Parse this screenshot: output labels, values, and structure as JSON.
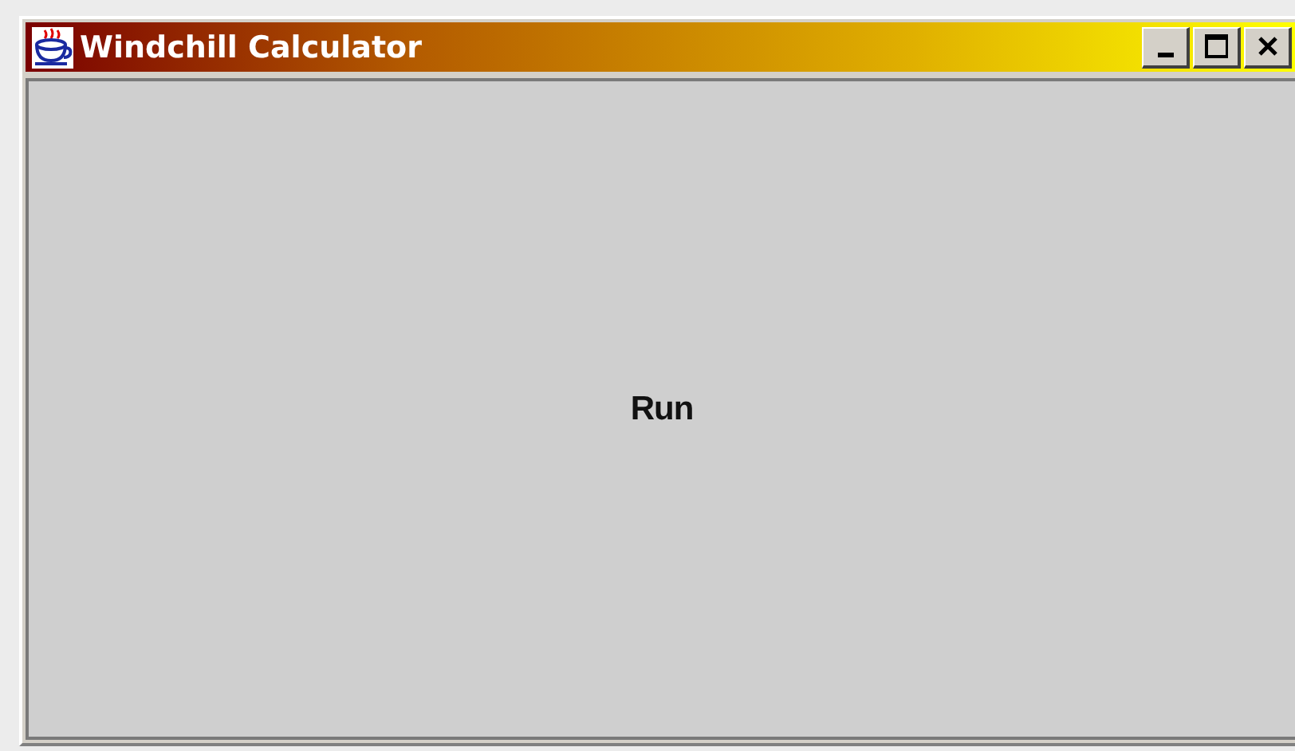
{
  "window": {
    "title": "Windchill Calculator"
  },
  "content": {
    "button": "Run"
  }
}
